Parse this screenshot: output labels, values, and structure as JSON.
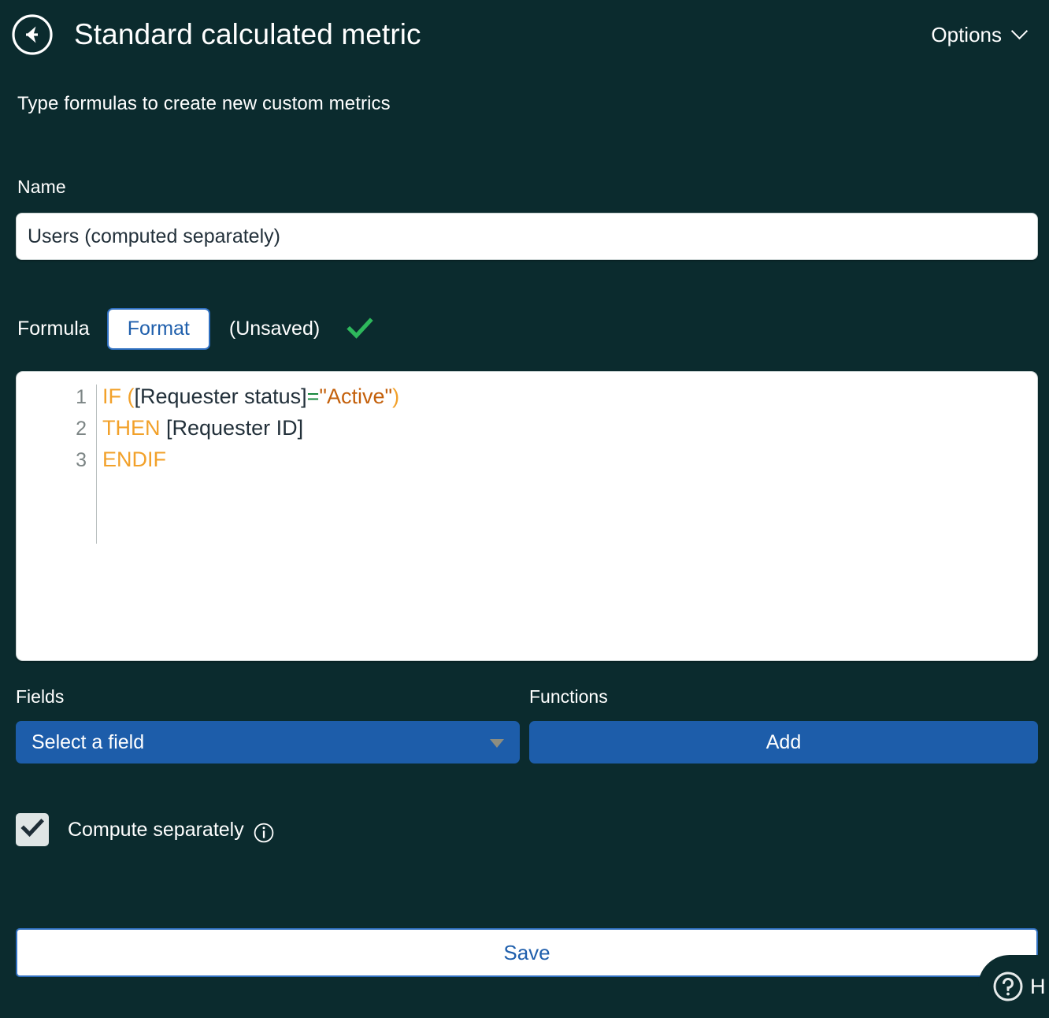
{
  "header": {
    "back_icon": "arrow-left-circle-icon",
    "title": "Standard calculated metric",
    "options_label": "Options",
    "options_chevron_icon": "chevron-down-icon"
  },
  "subtitle": "Type formulas to create new custom metrics",
  "name_section": {
    "label": "Name",
    "value": "Users (computed separately)",
    "placeholder": "Name"
  },
  "formula_section": {
    "formula_tab_label": "Formula",
    "format_tab_label": "Format",
    "status_label": "(Unsaved)",
    "valid_icon": "check-mark-icon"
  },
  "editor": {
    "lines": [
      {
        "number": "1",
        "tokens": [
          {
            "text": "IF (",
            "type": "keyword"
          },
          {
            "text": "[Requester status]",
            "type": "field"
          },
          {
            "text": "=",
            "type": "operator"
          },
          {
            "text": "\"Active\"",
            "type": "string"
          },
          {
            "text": ")",
            "type": "keyword"
          }
        ]
      },
      {
        "number": "2",
        "tokens": [
          {
            "text": "THEN",
            "type": "keyword"
          },
          {
            "text": " [Requester ID]",
            "type": "field"
          }
        ]
      },
      {
        "number": "3",
        "tokens": [
          {
            "text": "ENDIF",
            "type": "keyword"
          }
        ]
      }
    ]
  },
  "fields_section": {
    "label": "Fields",
    "select_label": "Select a field",
    "dropdown_icon": "triangle-down-icon"
  },
  "functions_section": {
    "label": "Functions",
    "add_label": "Add"
  },
  "compute": {
    "label": "Compute separately",
    "checked": true,
    "check_icon": "check-mark-icon",
    "info_icon": "info-circle-icon"
  },
  "save": {
    "label": "Save"
  },
  "help_widget": {
    "icon": "question-circle-icon",
    "label": "H"
  },
  "colors": {
    "background": "#0b2b2e",
    "accent_blue": "#1d5daa",
    "link_blue": "#1f5fac",
    "border_blue": "#2f6fc0",
    "keyword_orange": "#f2a12a",
    "string_orange": "#c4600b",
    "operator_green": "#17883d",
    "valid_green": "#2eb85c",
    "field_navy": "#22303a",
    "input_white": "#ffffff",
    "checkbox_bg": "#dfe5e5",
    "gutter_gray": "#7c8585"
  }
}
